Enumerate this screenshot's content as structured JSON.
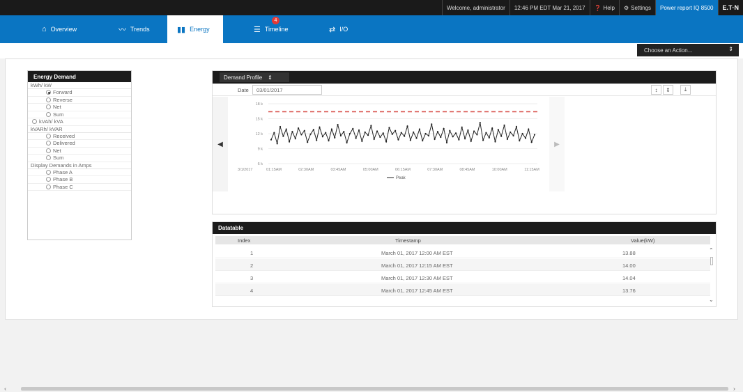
{
  "header": {
    "welcome": "Welcome, administrator",
    "datetime": "12:46 PM EDT Mar 21, 2017",
    "help": "Help",
    "settings": "Settings",
    "power_report": "Power report IQ 8500",
    "brand": "E.T·N"
  },
  "nav": {
    "tabs": [
      {
        "label": "Overview",
        "icon": "home-icon",
        "glyph": "⌂"
      },
      {
        "label": "Trends",
        "icon": "trend-icon",
        "glyph": "〰"
      },
      {
        "label": "Energy",
        "icon": "bar-chart-icon",
        "glyph": "▮▮"
      },
      {
        "label": "Timeline",
        "icon": "list-icon",
        "glyph": "☰",
        "badge": "4"
      },
      {
        "label": "I/O",
        "icon": "io-icon",
        "glyph": "⇄"
      }
    ],
    "active": "Energy"
  },
  "action_select": {
    "label": "Choose an Action...",
    "arrow": "⇕"
  },
  "energy_demand": {
    "title": "Energy Demand",
    "groups": [
      {
        "label": "kWh/ kW",
        "options": [
          {
            "label": "Forward",
            "checked": true
          },
          {
            "label": "Reverse",
            "checked": false
          },
          {
            "label": "Net",
            "checked": false
          },
          {
            "label": "Sum",
            "checked": false
          }
        ]
      },
      {
        "label": "",
        "options": [
          {
            "label": "kVAh/ kVA",
            "checked": false,
            "top_level": true
          }
        ]
      },
      {
        "label": "kVARh/ kVAR",
        "options": [
          {
            "label": "Received",
            "checked": false
          },
          {
            "label": "Delivered",
            "checked": false
          },
          {
            "label": "Net",
            "checked": false
          },
          {
            "label": "Sum",
            "checked": false
          }
        ]
      },
      {
        "label": "Display Demands in Amps",
        "options": [
          {
            "label": "Phase A",
            "checked": false
          },
          {
            "label": "Phase B",
            "checked": false
          },
          {
            "label": "Phase C",
            "checked": false
          }
        ]
      }
    ]
  },
  "demand_profile": {
    "select_label": "Demand Profile",
    "select_arrow": "⇕",
    "date_label": "Date",
    "date_value": "03/01/2017",
    "tools": [
      "↕",
      "⇕",
      "⤓"
    ],
    "nav_prev": "◀",
    "nav_next": "▶"
  },
  "chart_data": {
    "type": "line",
    "title": "",
    "xlabel": "",
    "ylabel": "",
    "y_ticks": [
      "18 k",
      "15 k",
      "12 k",
      "9 k",
      "6 k"
    ],
    "ylim": [
      6,
      18
    ],
    "x_start_label": "3/1/2017",
    "x_ticks": [
      "01:15AM",
      "02:30AM",
      "03:45AM",
      "05:00AM",
      "06:15AM",
      "07:30AM",
      "08:45AM",
      "10:00AM",
      "11:15AM"
    ],
    "threshold": 16.4,
    "threshold_color": "#d9534f",
    "series": [
      {
        "name": "Peak",
        "color": "#222222",
        "values": [
          10.8,
          12.2,
          10.0,
          13.4,
          11.5,
          12.9,
          10.4,
          12.4,
          11.0,
          13.1,
          11.8,
          12.6,
          10.3,
          11.9,
          12.8,
          10.7,
          13.3,
          11.4,
          12.2,
          10.6,
          12.9,
          11.2,
          13.8,
          11.6,
          12.4,
          10.2,
          12.0,
          13.0,
          11.1,
          12.7,
          10.5,
          12.3,
          11.7,
          13.6,
          10.9,
          12.5,
          11.3,
          12.1,
          10.4,
          13.2,
          11.9,
          12.6,
          10.8,
          12.2,
          11.5,
          13.5,
          10.7,
          12.3,
          11.1,
          12.9,
          10.6,
          12.0,
          11.6,
          13.9,
          10.9,
          12.4,
          11.3,
          13.0,
          10.2,
          12.6,
          11.4,
          12.1,
          10.8,
          13.3,
          11.0,
          12.7,
          10.5,
          12.5,
          11.8,
          14.2,
          10.7,
          12.2,
          11.2,
          13.1,
          10.4,
          12.8,
          11.5,
          13.7,
          10.9,
          12.3,
          11.6,
          13.4,
          10.6,
          12.0,
          11.1,
          12.9,
          10.3,
          11.8
        ]
      }
    ],
    "legend": "Peak"
  },
  "datatable": {
    "title": "Datatable",
    "columns": [
      "Index",
      "Timestamp",
      "Value(kW)"
    ],
    "rows": [
      [
        "1",
        "March 01, 2017 12:00 AM EST",
        "13.88"
      ],
      [
        "2",
        "March 01, 2017 12:15 AM EST",
        "14.00"
      ],
      [
        "3",
        "March 01, 2017 12:30 AM EST",
        "14.04"
      ],
      [
        "4",
        "March 01, 2017 12:45 AM EST",
        "13.76"
      ]
    ],
    "scroll_up": "⌃",
    "scroll_down": "⌄"
  },
  "hscroll": {
    "left": "‹",
    "right": "›"
  },
  "colors": {
    "brand_blue": "#0a75c2",
    "topbar": "#1a1a1a"
  }
}
